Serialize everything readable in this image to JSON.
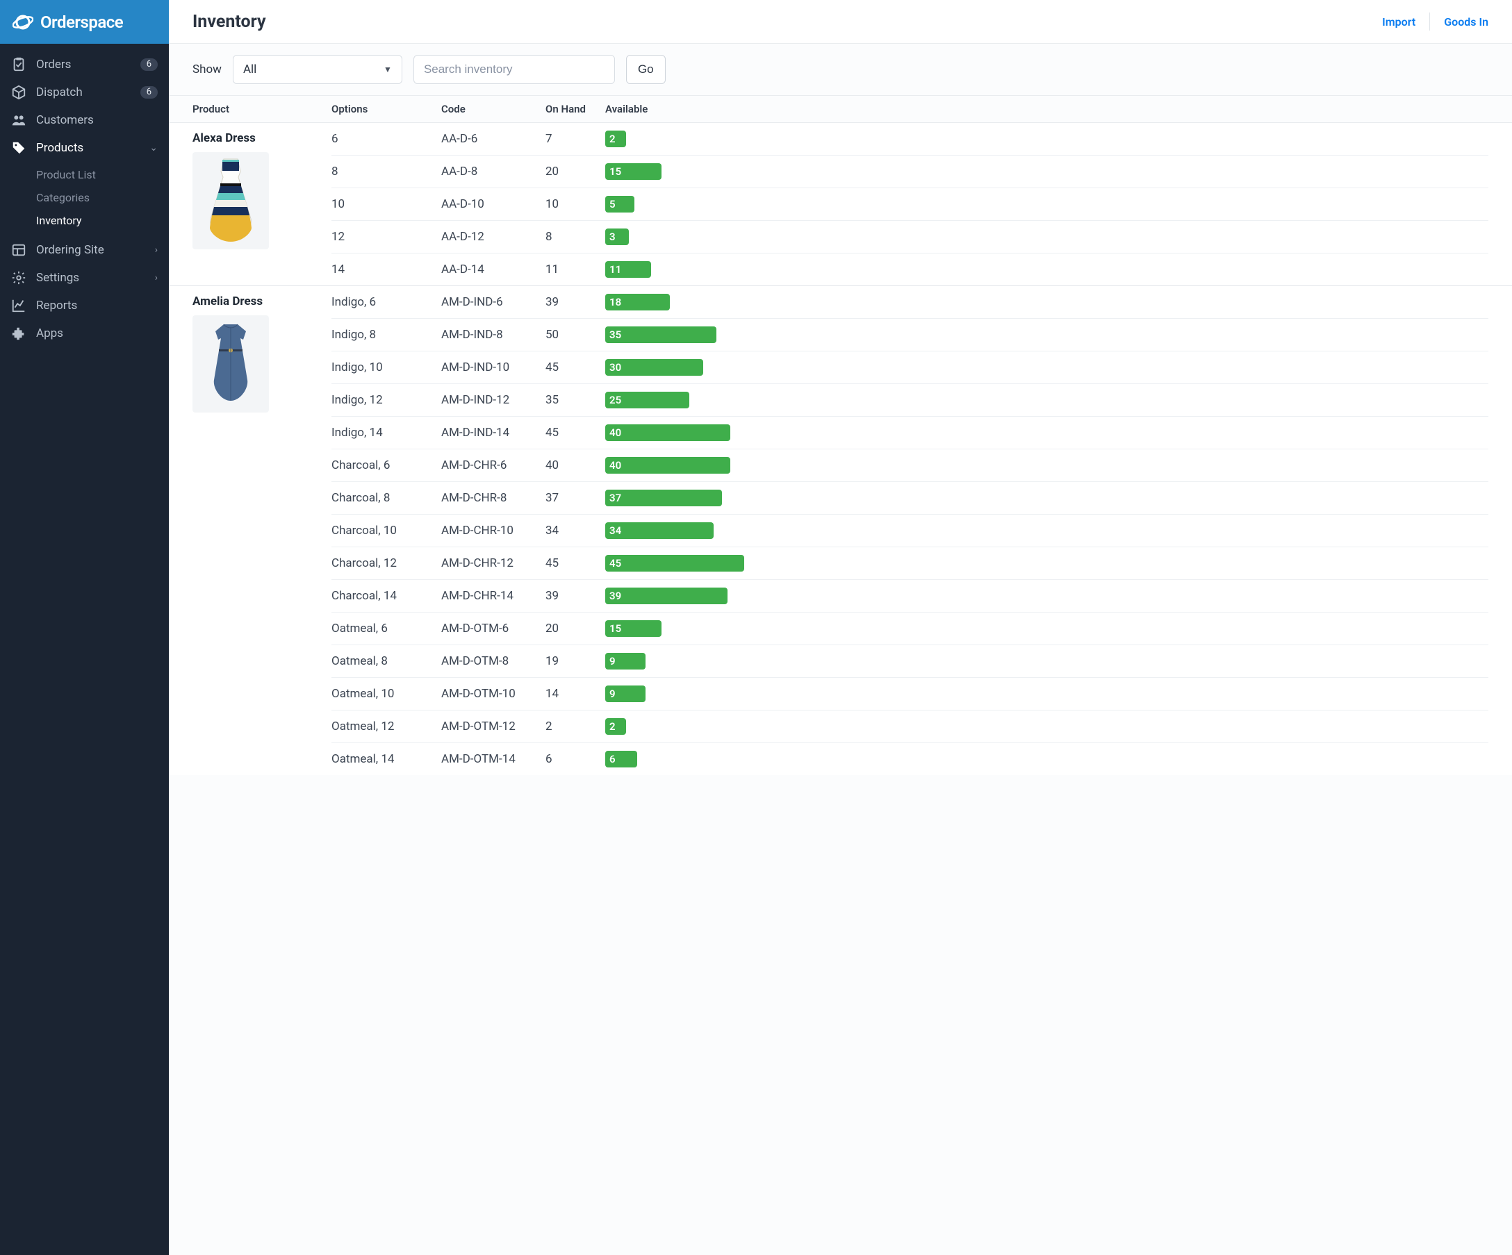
{
  "brand": "Orderspace",
  "header": {
    "title": "Inventory",
    "import_label": "Import",
    "goods_in_label": "Goods In"
  },
  "toolbar": {
    "show_label": "Show",
    "dropdown_value": "All",
    "search_placeholder": "Search inventory",
    "go_label": "Go"
  },
  "sidebar": [
    {
      "key": "orders",
      "label": "Orders",
      "icon": "clipboard-check",
      "badge": "6"
    },
    {
      "key": "dispatch",
      "label": "Dispatch",
      "icon": "package",
      "badge": "6"
    },
    {
      "key": "customers",
      "label": "Customers",
      "icon": "people"
    },
    {
      "key": "products",
      "label": "Products",
      "icon": "tag",
      "expanded": true,
      "chevron": "down",
      "children": [
        {
          "key": "product-list",
          "label": "Product List"
        },
        {
          "key": "categories",
          "label": "Categories"
        },
        {
          "key": "inventory",
          "label": "Inventory",
          "active": true
        }
      ]
    },
    {
      "key": "ordering-site",
      "label": "Ordering Site",
      "icon": "layout",
      "chevron": "right"
    },
    {
      "key": "settings",
      "label": "Settings",
      "icon": "gear",
      "chevron": "right"
    },
    {
      "key": "reports",
      "label": "Reports",
      "icon": "chart-line"
    },
    {
      "key": "apps",
      "label": "Apps",
      "icon": "puzzle"
    }
  ],
  "columns": {
    "product": "Product",
    "options": "Options",
    "code": "Code",
    "on_hand": "On Hand",
    "available": "Available"
  },
  "max_available": 45,
  "products": [
    {
      "name": "Alexa Dress",
      "image": "alexa",
      "variants": [
        {
          "options": "6",
          "code": "AA-D-6",
          "on_hand": "7",
          "available": 2
        },
        {
          "options": "8",
          "code": "AA-D-8",
          "on_hand": "20",
          "available": 15
        },
        {
          "options": "10",
          "code": "AA-D-10",
          "on_hand": "10",
          "available": 5
        },
        {
          "options": "12",
          "code": "AA-D-12",
          "on_hand": "8",
          "available": 3
        },
        {
          "options": "14",
          "code": "AA-D-14",
          "on_hand": "11",
          "available": 11
        }
      ]
    },
    {
      "name": "Amelia Dress",
      "image": "amelia",
      "variants": [
        {
          "options": "Indigo, 6",
          "code": "AM-D-IND-6",
          "on_hand": "39",
          "available": 18
        },
        {
          "options": "Indigo, 8",
          "code": "AM-D-IND-8",
          "on_hand": "50",
          "available": 35
        },
        {
          "options": "Indigo, 10",
          "code": "AM-D-IND-10",
          "on_hand": "45",
          "available": 30
        },
        {
          "options": "Indigo, 12",
          "code": "AM-D-IND-12",
          "on_hand": "35",
          "available": 25
        },
        {
          "options": "Indigo, 14",
          "code": "AM-D-IND-14",
          "on_hand": "45",
          "available": 40
        },
        {
          "options": "Charcoal, 6",
          "code": "AM-D-CHR-6",
          "on_hand": "40",
          "available": 40
        },
        {
          "options": "Charcoal, 8",
          "code": "AM-D-CHR-8",
          "on_hand": "37",
          "available": 37
        },
        {
          "options": "Charcoal, 10",
          "code": "AM-D-CHR-10",
          "on_hand": "34",
          "available": 34
        },
        {
          "options": "Charcoal, 12",
          "code": "AM-D-CHR-12",
          "on_hand": "45",
          "available": 45
        },
        {
          "options": "Charcoal, 14",
          "code": "AM-D-CHR-14",
          "on_hand": "39",
          "available": 39
        },
        {
          "options": "Oatmeal, 6",
          "code": "AM-D-OTM-6",
          "on_hand": "20",
          "available": 15
        },
        {
          "options": "Oatmeal, 8",
          "code": "AM-D-OTM-8",
          "on_hand": "19",
          "available": 9
        },
        {
          "options": "Oatmeal, 10",
          "code": "AM-D-OTM-10",
          "on_hand": "14",
          "available": 9
        },
        {
          "options": "Oatmeal, 12",
          "code": "AM-D-OTM-12",
          "on_hand": "2",
          "available": 2
        },
        {
          "options": "Oatmeal, 14",
          "code": "AM-D-OTM-14",
          "on_hand": "6",
          "available": 6
        }
      ]
    }
  ]
}
